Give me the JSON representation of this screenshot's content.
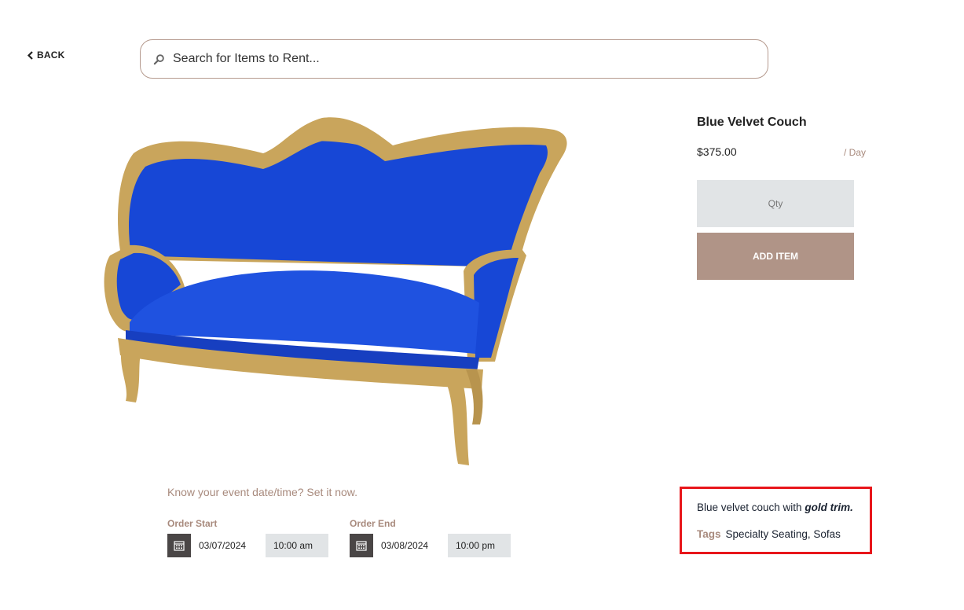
{
  "nav": {
    "back_label": "BACK"
  },
  "search": {
    "placeholder": "Search for Items to Rent..."
  },
  "product": {
    "title": "Blue Velvet Couch",
    "price": "$375.00",
    "period": "/ Day",
    "qty_placeholder": "Qty",
    "add_label": "ADD ITEM",
    "description_prefix": "Blue velvet couch with ",
    "description_emphasis": "gold trim.",
    "tags_label": "Tags",
    "tags": "Specialty Seating, Sofas"
  },
  "event": {
    "prompt": "Know your event date/time? Set it now.",
    "start_label": "Order Start",
    "start_date": "03/07/2024",
    "start_time": "10:00 am",
    "end_label": "Order End",
    "end_date": "03/08/2024",
    "end_time": "10:00 pm"
  },
  "colors": {
    "accent": "#b09487",
    "highlight_border": "#e8161b",
    "velvet": "#1747d6",
    "gold": "#c9a55c"
  }
}
